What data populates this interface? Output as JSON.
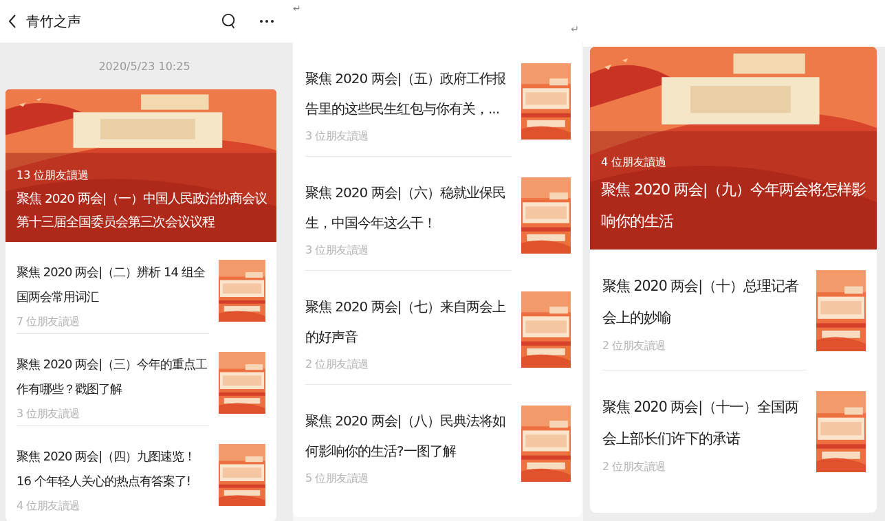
{
  "panels": [
    {
      "header": {
        "title": "青竹之声"
      },
      "timestamp": "2020/5/23 10:25",
      "lead": {
        "reads": "13 位朋友讀過",
        "title": "聚焦 2020 两会|（一）中国人民政治协商会议第十三届全国委员会第三次会议议程"
      },
      "articles": [
        {
          "title": "聚焦 2020 两会|（二）辨析 14 组全国两会常用词汇",
          "reads": "7 位朋友讀過"
        },
        {
          "title": "聚焦 2020 两会|（三）今年的重点工作有哪些？戳图了解",
          "reads": "3 位朋友讀過"
        },
        {
          "title": "聚焦 2020 两会|（四）九图速览！16 个年轻人关心的热点有答案了!",
          "reads": "4 位朋友讀過"
        }
      ]
    },
    {
      "marks": [
        "↵",
        "↵"
      ],
      "articles": [
        {
          "title": "聚焦 2020 两会|（五）政府工作报告里的这些民生红包与你有关，...",
          "reads": "3 位朋友讀過"
        },
        {
          "title": "聚焦 2020 两会|（六）稳就业保民生，中国今年这么干！",
          "reads": "3 位朋友讀過"
        },
        {
          "title": "聚焦 2020 两会|（七）来自两会上的好声音",
          "reads": "2 位朋友讀過"
        },
        {
          "title": "聚焦 2020 两会|（八）民典法将如何影响你的生活?一图了解",
          "reads": "5 位朋友讀過"
        }
      ]
    },
    {
      "lead": {
        "reads": "4 位朋友讀過",
        "title": "聚焦 2020 两会|（九）今年两会将怎样影响你的生活"
      },
      "articles": [
        {
          "title": "聚焦 2020 两会|（十）总理记者会上的妙喻",
          "reads": "2 位朋友讀過"
        },
        {
          "title": "聚焦 2020 两会|（十一）全国两会上部长们许下的承诺",
          "reads": "2 位朋友讀過"
        }
      ]
    }
  ]
}
